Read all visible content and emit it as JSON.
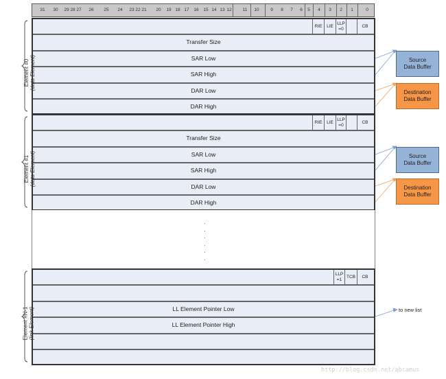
{
  "bit_header": {
    "cells": [
      {
        "label": "31"
      },
      {
        "label": "30"
      },
      {
        "label": "29"
      },
      {
        "label": "28"
      },
      {
        "label": "27"
      },
      {
        "label": "26"
      },
      {
        "label": "25"
      },
      {
        "label": "24"
      },
      {
        "label": "23"
      },
      {
        "label": "22"
      },
      {
        "label": "21"
      },
      {
        "label": "20"
      },
      {
        "label": "19"
      },
      {
        "label": "18"
      },
      {
        "label": "17"
      },
      {
        "label": "16"
      },
      {
        "label": "15"
      },
      {
        "label": "14"
      },
      {
        "label": "13"
      },
      {
        "label": "12"
      },
      {
        "label": "11"
      },
      {
        "label": "10"
      },
      {
        "label": "9"
      },
      {
        "label": "8"
      },
      {
        "label": "7"
      },
      {
        "label": "6"
      },
      {
        "label": "5"
      },
      {
        "label": "4"
      },
      {
        "label": "3"
      },
      {
        "label": "2"
      },
      {
        "label": "1"
      },
      {
        "label": "0"
      }
    ]
  },
  "elements": [
    {
      "side_label_line1": "Element #0",
      "side_label_line2": "(data Element)",
      "flags": [
        "RIE",
        "LIE",
        "LLP\n=0",
        "",
        "CB"
      ],
      "rows": [
        "Transfer Size",
        "SAR Low",
        "SAR High",
        "DAR Low",
        "DAR High"
      ]
    },
    {
      "side_label_line1": "Element #1",
      "side_label_line2": "(data Element)",
      "flags": [
        "RIE",
        "LIE",
        "LLP\n=0",
        "",
        "CB"
      ],
      "rows": [
        "Transfer Size",
        "SAR Low",
        "SAR High",
        "DAR Low",
        "DAR High"
      ]
    },
    {
      "side_label_line1": "Element #N-1",
      "side_label_line2": "(link Element)",
      "flags": [
        "LLP\n=1",
        "TCB",
        "CB"
      ],
      "rows": [
        "",
        "LL Element Pointer Low",
        "LL Element Pointer High",
        "",
        ""
      ]
    }
  ],
  "buffers": {
    "source_line1": "Source",
    "source_line2": "Data Buffer",
    "dest_line1": "Destination",
    "dest_line2": "Data Buffer",
    "source_color": "#95b3d7",
    "dest_color": "#f79646"
  },
  "link_target": "to new list",
  "watermark": "http://blog.csdn.net/abcamus"
}
